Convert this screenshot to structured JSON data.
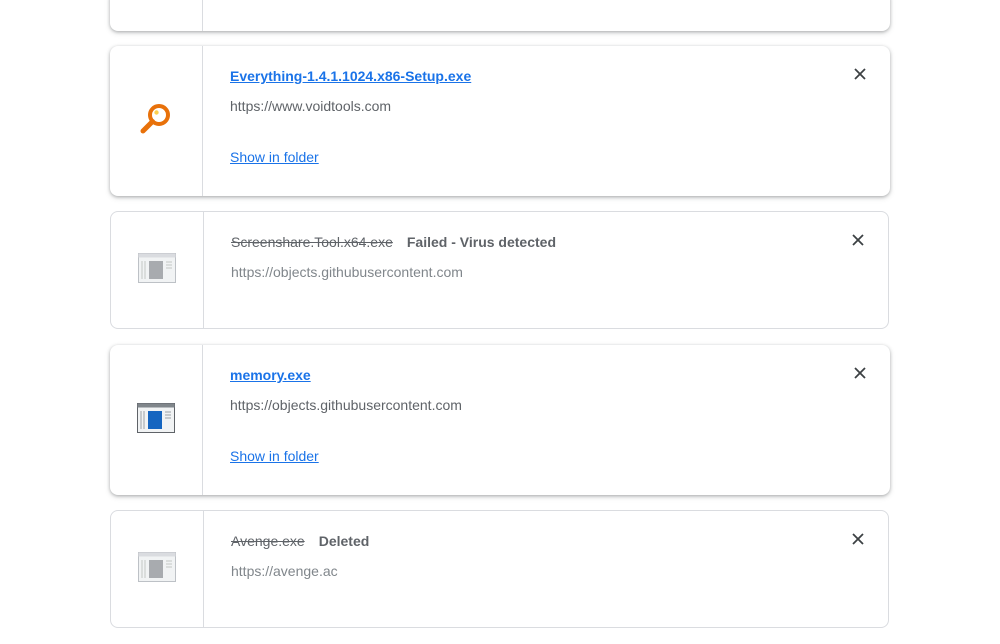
{
  "downloads": [
    {
      "file_name": "",
      "url": "",
      "status": "",
      "action": ""
    },
    {
      "file_name": "Everything-1.4.1.1024.x86-Setup.exe",
      "url": "https://www.voidtools.com",
      "status": "",
      "action": "Show in folder",
      "icon": "magnifier-icon",
      "state": "completed"
    },
    {
      "file_name": "Screenshare.Tool.x64.exe",
      "url": "https://objects.githubusercontent.com",
      "status": "Failed - Virus detected",
      "action": "",
      "icon": "generic-file-icon",
      "state": "failed"
    },
    {
      "file_name": "memory.exe",
      "url": "https://objects.githubusercontent.com",
      "status": "",
      "action": "Show in folder",
      "icon": "window-app-icon",
      "state": "completed"
    },
    {
      "file_name": "Avenge.exe",
      "url": "https://avenge.ac",
      "status": "Deleted",
      "action": "",
      "icon": "generic-file-icon",
      "state": "deleted"
    }
  ],
  "colors": {
    "link": "#1a73e8",
    "muted_text": "#5f6368",
    "border": "#dadce0",
    "accent_orange": "#e8710a",
    "app_blue": "#1565c0"
  }
}
